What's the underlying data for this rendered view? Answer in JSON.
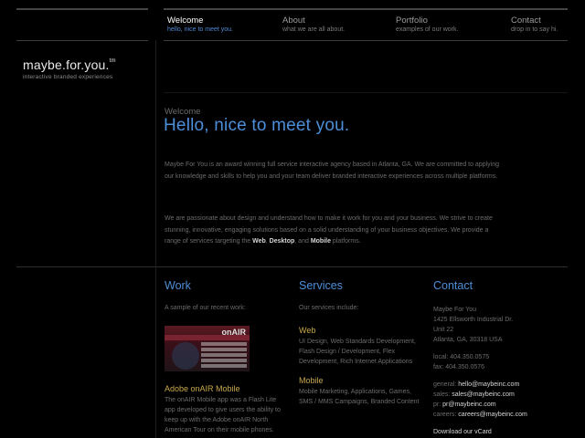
{
  "logo": {
    "name": "maybe.for.you.",
    "tm": "tm",
    "tagline": "interactive branded experiences"
  },
  "nav": [
    {
      "title": "Welcome",
      "sub": "hello, nice to meet you."
    },
    {
      "title": "About",
      "sub": "what we are all about."
    },
    {
      "title": "Portfolio",
      "sub": "examples of our work."
    },
    {
      "title": "Contact",
      "sub": "drop in to say hi."
    }
  ],
  "hero": {
    "eyebrow": "Welcome",
    "headline": "Hello, nice to meet you.",
    "para1": "Maybe For You is an award winning full service interactive agency based in Atlanta, GA. We are committed to applying our knowledge and skills to help you and your team deliver branded interactive experiences across multiple platforms.",
    "para2_pre": "We are passionate about design and understand how to make it work for you and your business. We strive to create stunning, innovative, engaging solutions based on a solid understanding of your business objectives. We provide a range of services targeting the ",
    "para2_web": "Web",
    "para2_sep1": ", ",
    "para2_desktop": "Desktop",
    "para2_sep2": ", and ",
    "para2_mobile": "Mobile",
    "para2_post": " platforms."
  },
  "work": {
    "title": "Work",
    "intro": "A sample of our recent work:",
    "image_brand": "onAIR",
    "item_title": "Adobe onAIR Mobile",
    "item_desc": "The onAIR Mobile app was a Flash Lite app developed to give users the ability to keep up with the Adobe onAIR North American Tour on their mobile phones."
  },
  "services": {
    "title": "Services",
    "intro": "Our services include:",
    "web_title": "Web",
    "web_desc": "UI Design, Web Standards Development, Flash Design / Development, Flex Development, Rich Internet Applications",
    "mobile_title": "Mobile",
    "mobile_desc": "Mobile Marketing, Applications, Games, SMS / MMS Campaigns, Branded Content"
  },
  "contact": {
    "title": "Contact",
    "company": "Maybe For You",
    "addr1": "1425 Ellsworth Industrial Dr.",
    "addr2": "Unit 22",
    "addr3": "Atlanta, GA, 30318 USA",
    "local": "local: 404.350.0575",
    "fax": "fax: 404.350.0576",
    "general_label": "general:",
    "general_email": "hello@maybeinc.com",
    "sales_label": "sales:",
    "sales_email": "sales@maybeinc.com",
    "pr_label": "pr:",
    "pr_email": "pr@maybeinc.com",
    "careers_label": "careers:",
    "careers_email": "careers@maybeinc.com",
    "vcard": "Download our vCard"
  },
  "colors": {
    "accent": "#4c8ed8",
    "gold": "#c9a84c",
    "bg": "#000000"
  }
}
